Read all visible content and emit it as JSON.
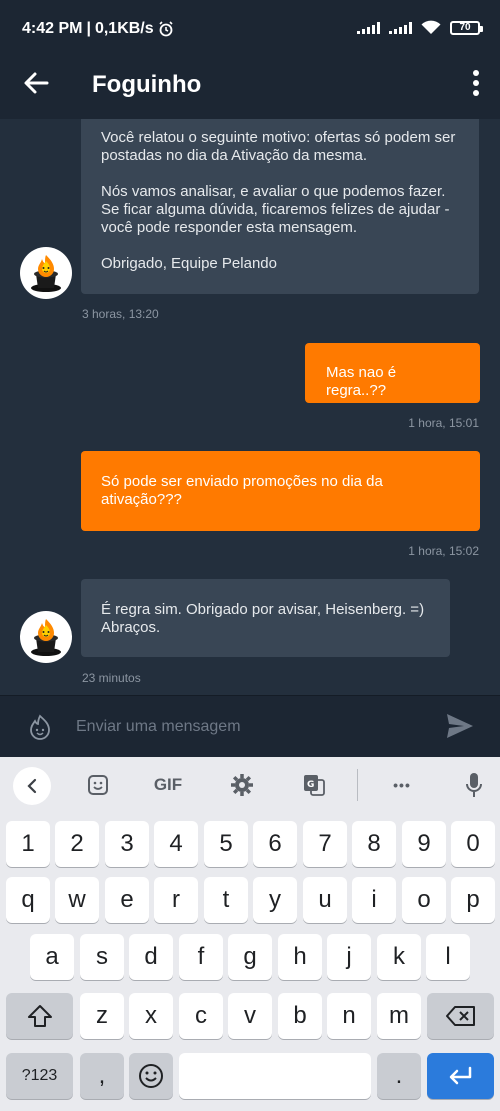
{
  "status_bar": {
    "time": "4:42 PM",
    "separator": "|",
    "network_speed": "0,1KB/s",
    "battery": "70",
    "icons": [
      "alarm-icon",
      "signal-icon",
      "signal-icon",
      "wifi-icon",
      "battery-icon"
    ]
  },
  "app_bar": {
    "title": "Foguinho",
    "back_icon": "arrow-left-icon",
    "menu_icon": "more-vert-icon"
  },
  "messages": [
    {
      "direction": "in",
      "paragraphs": [
        "Você relatou o seguinte motivo: ofertas só podem ser postadas no dia da Ativação da mesma.",
        "Nós vamos analisar, e avaliar o que podemos fazer. Se ficar alguma dúvida, ficaremos felizes de ajudar - você pode responder esta mensagem.",
        "Obrigado, Equipe Pelando"
      ],
      "time": "3 horas, 13:20"
    },
    {
      "direction": "out",
      "text": "Mas nao é regra..??",
      "time": "1 hora, 15:01"
    },
    {
      "direction": "out",
      "text": "Só pode ser enviado promoções no dia da ativação???",
      "time": "1 hora, 15:02"
    },
    {
      "direction": "in",
      "text": "É regra sim. Obrigado por avisar, Heisenberg. =)\nAbraços.",
      "time": "23 minutos"
    }
  ],
  "composer": {
    "placeholder": "Enviar uma mensagem",
    "emoji_icon": "emoji-icon",
    "send_icon": "send-icon"
  },
  "keyboard": {
    "toolbar": {
      "gif_label": "GIF",
      "icons": [
        "chevron-left-icon",
        "sticker-icon",
        "gear-icon",
        "translate-icon",
        "more-horiz-icon",
        "mic-icon"
      ],
      "more_label": "•••"
    },
    "row_numbers": [
      "1",
      "2",
      "3",
      "4",
      "5",
      "6",
      "7",
      "8",
      "9",
      "0"
    ],
    "row1": [
      "q",
      "w",
      "e",
      "r",
      "t",
      "y",
      "u",
      "i",
      "o",
      "p"
    ],
    "row2": [
      "a",
      "s",
      "d",
      "f",
      "g",
      "h",
      "j",
      "k",
      "l"
    ],
    "row3": [
      "z",
      "x",
      "c",
      "v",
      "b",
      "n",
      "m"
    ],
    "symbols_label": "?123",
    "comma_label": ",",
    "period_label": ".",
    "colors": {
      "enter": "#2b7bdc"
    }
  },
  "colors": {
    "background": "#232f3d",
    "incoming_bubble": "#394655",
    "outgoing_bubble": "#ff7a00",
    "accent": "#ff7a00"
  }
}
